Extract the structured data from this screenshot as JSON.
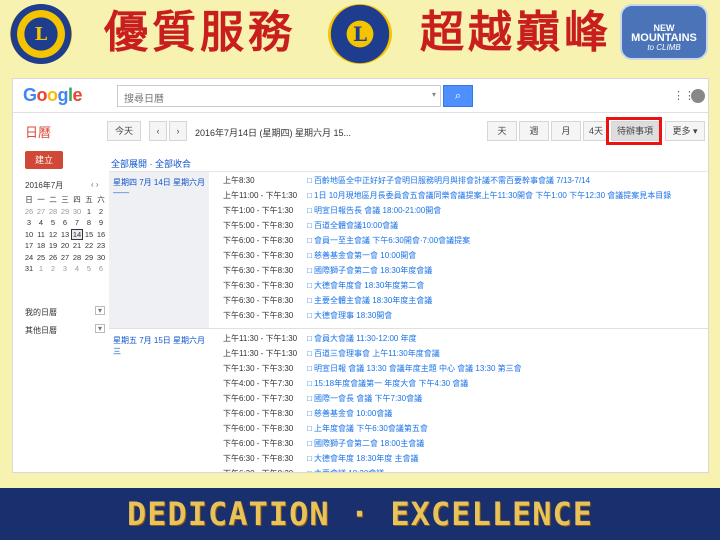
{
  "banner": {
    "motto_left": "優質服務",
    "motto_right": "超越巔峰",
    "badge_left_text": "L",
    "badge_mid_text": "L",
    "badge_mid_caption": "LIONS",
    "badge_right_line1": "NEW",
    "badge_right_line2": "MOUNTAINS",
    "badge_right_line3": "to CLIMB"
  },
  "app": {
    "logo": [
      "G",
      "o",
      "o",
      "g",
      "l",
      "e"
    ],
    "search_value": "搜尋日曆",
    "search_icon": "search-icon",
    "user": "  ",
    "apps_icon": "⋮⋮⋮",
    "share_icon": "●"
  },
  "toolbar": {
    "calendar_title": "日曆",
    "today": "今天",
    "prev": "‹",
    "next": "›",
    "date_range": "2016年7月14日 (星期四) 星期六月 15...",
    "views": [
      "天",
      "週",
      "月",
      "4天",
      "待辦事項"
    ],
    "more": "更多 ▾",
    "selected_view": "待辦事項"
  },
  "sidebar": {
    "create": "建立",
    "month_label": "2016年7月",
    "weekdays": [
      "日",
      "一",
      "二",
      "三",
      "四",
      "五",
      "六"
    ],
    "days": [
      [
        "26",
        "27",
        "28",
        "29",
        "30",
        "1",
        "2"
      ],
      [
        "3",
        "4",
        "5",
        "6",
        "7",
        "8",
        "9"
      ],
      [
        "10",
        "11",
        "12",
        "13",
        "14",
        "15",
        "16"
      ],
      [
        "17",
        "18",
        "19",
        "20",
        "21",
        "22",
        "23"
      ],
      [
        "24",
        "25",
        "26",
        "27",
        "28",
        "29",
        "30"
      ],
      [
        "31",
        "1",
        "2",
        "3",
        "4",
        "5",
        "6"
      ]
    ],
    "today_day": "14",
    "my_calendars": "我的日曆",
    "other_calendars": "其他日曆"
  },
  "agenda": {
    "expand_links": "全部展開 · 全部收合",
    "days": [
      {
        "label": "星期四 7月 14日 星期六月——",
        "events": [
          {
            "time": "上午8:30",
            "title": "□ 百齡地區全中正好好子會明日服務明月與排會計議不需百要幹事會議 7/13-7/14"
          },
          {
            "time": "上午11:00 - 下午1:30",
            "title": "□ 1日 10月現地區月長委員會五會議同樂會議提案上午11:30開會 下午1:00 下午12:30 會議提案見本目錄"
          },
          {
            "time": "下午1:00 - 下午1:30",
            "title": "□ 明宣日報告長 會議 18:00-21:00開會"
          },
          {
            "time": "下午5:00 - 下午8:30",
            "title": "□ 百道全體會議10:00會議"
          },
          {
            "time": "下午6:00 - 下午8:30",
            "title": "□ 會員一至主會議 下午6:30開會·7:00會議提案"
          },
          {
            "time": "下午6:30 - 下午8:30",
            "title": "□ 慈善基金會第一會 10:00開會"
          },
          {
            "time": "下午6:30 - 下午8:30",
            "title": "□ 國際獅子會第二會 18:30年度會議"
          },
          {
            "time": "下午6:30 - 下午8:30",
            "title": "□ 大德會年度會 18:30年度第二會"
          },
          {
            "time": "下午6:30 - 下午8:30",
            "title": "□ 主要全體主會議 18:30年度主會議"
          },
          {
            "time": "下午6:30 - 下午8:30",
            "title": "□ 大德會理事 18:30開會"
          }
        ]
      },
      {
        "label": "星期五 7月 15日 星期六月 三",
        "events": [
          {
            "time": "上午11:30 - 下午1:30",
            "title": "□ 會員大會議 11:30-12:00 年度"
          },
          {
            "time": "上午11:30 - 下午1:30",
            "title": "□ 百道三會理事會 上午11:30年度會議"
          },
          {
            "time": "下午1:30 - 下午3:30",
            "title": "□ 明宣日報 會議 13:30 會議年度主題 中心 會議 13:30 第三會"
          },
          {
            "time": "下午4:00 - 下午7:30",
            "title": "□ 15:18年度會議第一 年度大會 下午4:30 會議"
          },
          {
            "time": "下午6:00 - 下午7:30",
            "title": "□ 國際一會長 會議 下午7:30會議"
          },
          {
            "time": "下午6:00 - 下午8:30",
            "title": "□ 慈善基金會 10:00會議"
          },
          {
            "time": "下午6:00 - 下午8:30",
            "title": "□ 上年度會議 下午6:30會議第五會"
          },
          {
            "time": "下午6:00 - 下午8:30",
            "title": "□ 國際獅子會第二會 18:00主會議"
          },
          {
            "time": "下午6:30 - 下午8:30",
            "title": "□ 大德會年度 18:30年度 主會議"
          },
          {
            "time": "下午6:30 - 下午8:30",
            "title": "□ 主要會議 18:30會議"
          }
        ]
      }
    ]
  },
  "footer": {
    "text": "DEDICATION · EXCELLENCE"
  },
  "colors": {
    "banner_bg": "#f7f2b0",
    "frame_bg": "#1a2f6e",
    "motto": "#c81e1e",
    "highlight": "#e11111",
    "create_button": "#d14836",
    "footer_text": "#e8c25a"
  }
}
